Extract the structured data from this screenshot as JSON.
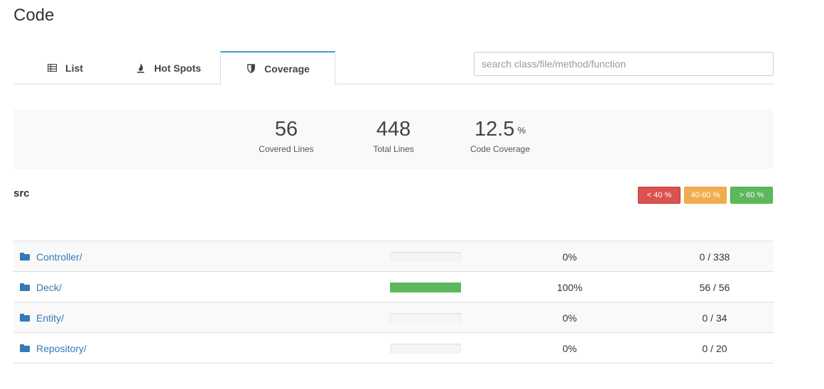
{
  "page": {
    "title": "Code"
  },
  "tabs": [
    {
      "label": "List",
      "icon": "table-icon",
      "active": false
    },
    {
      "label": "Hot Spots",
      "icon": "fire-icon",
      "active": false
    },
    {
      "label": "Coverage",
      "icon": "shield-icon",
      "active": true
    }
  ],
  "search": {
    "placeholder": "search class/file/method/function",
    "value": ""
  },
  "stats": {
    "covered": {
      "value": "56",
      "label": "Covered Lines"
    },
    "total": {
      "value": "448",
      "label": "Total Lines"
    },
    "coverage": {
      "value": "12.5",
      "unit": "%",
      "label": "Code Coverage"
    }
  },
  "section": {
    "title": "src"
  },
  "legend": {
    "low": {
      "label": "< 40 %",
      "color": "#d9534f"
    },
    "mid": {
      "label": "40-60 %",
      "color": "#f0ad4e"
    },
    "high": {
      "label": "> 60 %",
      "color": "#5cb85c"
    }
  },
  "rows": [
    {
      "name": "Controller/",
      "coverage_fraction": 0,
      "percent": "0%",
      "lines": "0 / 338"
    },
    {
      "name": "Deck/",
      "coverage_fraction": 1,
      "percent": "100%",
      "lines": "56 / 56"
    },
    {
      "name": "Entity/",
      "coverage_fraction": 0,
      "percent": "0%",
      "lines": "0 / 34"
    },
    {
      "name": "Repository/",
      "coverage_fraction": 0,
      "percent": "0%",
      "lines": "0 / 20"
    }
  ]
}
